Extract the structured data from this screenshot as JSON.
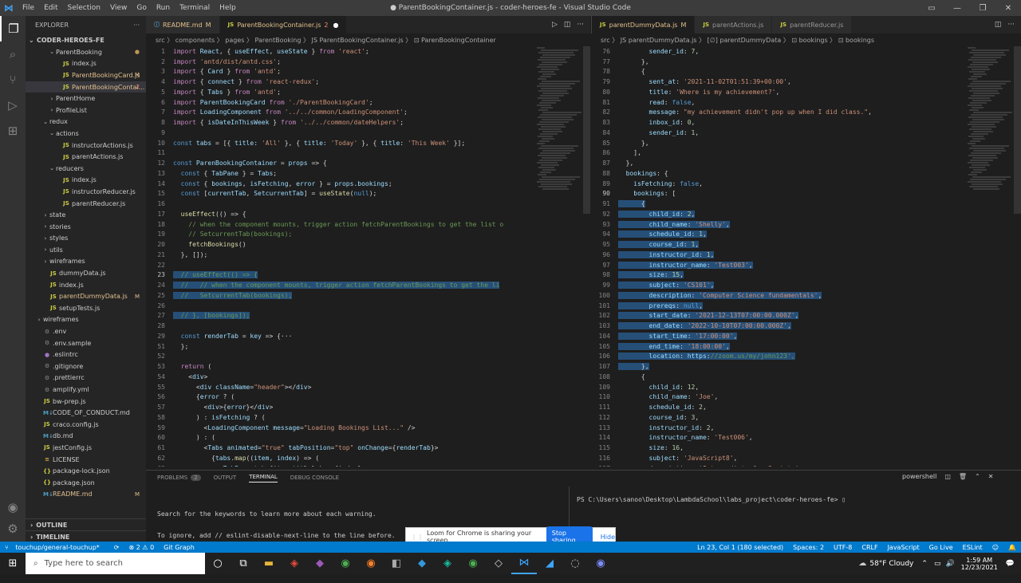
{
  "title_bar": {
    "menus": [
      "File",
      "Edit",
      "Selection",
      "View",
      "Go",
      "Run",
      "Terminal",
      "Help"
    ],
    "window_title": "● ParentBookingContainer.js - coder-heroes-fe - Visual Studio Code"
  },
  "activity_bar": [
    "explorer-icon",
    "search-icon",
    "source-control-icon",
    "run-debug-icon",
    "extensions-icon"
  ],
  "sidebar": {
    "header": "EXPLORER",
    "root": "CODER-HEROES-FE",
    "items": [
      {
        "label": "ParentBooking",
        "kind": "folder",
        "depth": 3,
        "open": true,
        "status": "dot"
      },
      {
        "label": "index.js",
        "kind": "js",
        "depth": 4,
        "status": ""
      },
      {
        "label": "ParentBookingCard.js",
        "kind": "js",
        "depth": 4,
        "status": "M"
      },
      {
        "label": "ParentBookingContai...",
        "kind": "js",
        "depth": 4,
        "status": "2",
        "selected": true
      },
      {
        "label": "ParentHome",
        "kind": "folder",
        "depth": 3,
        "open": false,
        "status": ""
      },
      {
        "label": "ProfileList",
        "kind": "folder",
        "depth": 3,
        "open": false,
        "status": ""
      },
      {
        "label": "redux",
        "kind": "folder",
        "depth": 2,
        "open": true,
        "status": ""
      },
      {
        "label": "actions",
        "kind": "folder",
        "depth": 3,
        "open": true,
        "status": ""
      },
      {
        "label": "instructorActions.js",
        "kind": "js",
        "depth": 4,
        "status": ""
      },
      {
        "label": "parentActions.js",
        "kind": "js",
        "depth": 4,
        "status": ""
      },
      {
        "label": "reducers",
        "kind": "folder",
        "depth": 3,
        "open": true,
        "status": ""
      },
      {
        "label": "index.js",
        "kind": "js",
        "depth": 4,
        "status": ""
      },
      {
        "label": "instructorReducer.js",
        "kind": "js",
        "depth": 4,
        "status": ""
      },
      {
        "label": "parentReducer.js",
        "kind": "js",
        "depth": 4,
        "status": ""
      },
      {
        "label": "state",
        "kind": "folder",
        "depth": 2,
        "open": false,
        "status": ""
      },
      {
        "label": "stories",
        "kind": "folder",
        "depth": 2,
        "open": false,
        "status": ""
      },
      {
        "label": "styles",
        "kind": "folder",
        "depth": 2,
        "open": false,
        "status": ""
      },
      {
        "label": "utils",
        "kind": "folder",
        "depth": 2,
        "open": false,
        "status": ""
      },
      {
        "label": "wireframes",
        "kind": "folder",
        "depth": 2,
        "open": false,
        "status": ""
      },
      {
        "label": "dummyData.js",
        "kind": "js",
        "depth": 2,
        "status": ""
      },
      {
        "label": "index.js",
        "kind": "js",
        "depth": 2,
        "status": ""
      },
      {
        "label": "parentDummyData.js",
        "kind": "js",
        "depth": 2,
        "status": "M"
      },
      {
        "label": "setupTests.js",
        "kind": "js",
        "depth": 2,
        "status": ""
      },
      {
        "label": "wireframes",
        "kind": "folder",
        "depth": 1,
        "open": false,
        "status": ""
      },
      {
        "label": ".env",
        "kind": "gear",
        "depth": 1,
        "status": ""
      },
      {
        "label": ".env.sample",
        "kind": "gear",
        "depth": 1,
        "status": ""
      },
      {
        "label": ".eslintrc",
        "kind": "dot",
        "depth": 1,
        "status": ""
      },
      {
        "label": ".gitignore",
        "kind": "gear",
        "depth": 1,
        "status": ""
      },
      {
        "label": ".prettierrc",
        "kind": "gear",
        "depth": 1,
        "status": ""
      },
      {
        "label": "amplify.yml",
        "kind": "gear",
        "depth": 1,
        "status": ""
      },
      {
        "label": "bw-prep.js",
        "kind": "js",
        "depth": 1,
        "status": ""
      },
      {
        "label": "CODE_OF_CONDUCT.md",
        "kind": "md",
        "depth": 1,
        "status": ""
      },
      {
        "label": "craco.config.js",
        "kind": "js",
        "depth": 1,
        "status": ""
      },
      {
        "label": "db.md",
        "kind": "md",
        "depth": 1,
        "status": ""
      },
      {
        "label": "jestConfig.js",
        "kind": "js",
        "depth": 1,
        "status": ""
      },
      {
        "label": "LICENSE",
        "kind": "lic",
        "depth": 1,
        "status": ""
      },
      {
        "label": "package-lock.json",
        "kind": "json",
        "depth": 1,
        "status": ""
      },
      {
        "label": "package.json",
        "kind": "json",
        "depth": 1,
        "status": ""
      },
      {
        "label": "README.md",
        "kind": "md",
        "depth": 1,
        "status": "M"
      }
    ],
    "outline": "OUTLINE",
    "timeline": "TIMELINE"
  },
  "left_editor": {
    "tabs": [
      {
        "label": "README.md",
        "badge": "M",
        "active": false,
        "icon": "md"
      },
      {
        "label": "ParentBookingContainer.js",
        "badge": "2",
        "active": true,
        "icon": "js",
        "unsaved": true
      }
    ],
    "breadcrumb": "src 〉 components 〉 pages 〉 ParentBooking 〉 JS ParentBookingContainer.js 〉 ⊡ ParenBookingContainer",
    "lines": [
      {
        "n": "1",
        "t": "import React, { useEffect, useState } from 'react';"
      },
      {
        "n": "2",
        "t": "import 'antd/dist/antd.css';"
      },
      {
        "n": "3",
        "t": "import { Card } from 'antd';"
      },
      {
        "n": "4",
        "t": "import { connect } from 'react-redux';"
      },
      {
        "n": "5",
        "t": "import { Tabs } from 'antd';"
      },
      {
        "n": "6",
        "t": "import ParentBookingCard from './ParentBookingCard';"
      },
      {
        "n": "7",
        "t": "import LoadingComponent from '../../common/LoadingComponent';"
      },
      {
        "n": "8",
        "t": "import { isDateInThisWeek } from '../../common/dateHelpers';"
      },
      {
        "n": "9",
        "t": ""
      },
      {
        "n": "10",
        "t": "const tabs = [{ title: 'All' }, { title: 'Today' }, { title: 'This Week' }];"
      },
      {
        "n": "11",
        "t": ""
      },
      {
        "n": "12",
        "t": "const ParenBookingContainer = props => {"
      },
      {
        "n": "13",
        "t": "  const { TabPane } = Tabs;"
      },
      {
        "n": "14",
        "t": "  const { bookings, isFetching, error } = props.bookings;"
      },
      {
        "n": "15",
        "t": "  const [currentTab, SetcurrentTab] = useState(null);"
      },
      {
        "n": "16",
        "t": ""
      },
      {
        "n": "17",
        "t": "  useEffect(() => {"
      },
      {
        "n": "18",
        "t": "    // when the component mounts, trigger action fetchParentBookings to get the list o"
      },
      {
        "n": "19",
        "t": "    // SetcurrentTab(bookings);"
      },
      {
        "n": "20",
        "t": "    fetchBookings()"
      },
      {
        "n": "21",
        "t": "  }, []);"
      },
      {
        "n": "22",
        "t": ""
      },
      {
        "n": "23",
        "t": "  // useEffect(() => {",
        "hl": true
      },
      {
        "n": "24",
        "t": "  //   // when the component mounts, trigger action fetchParentBookings to get the li",
        "hl": true
      },
      {
        "n": "25",
        "t": "  //   SetcurrentTab(bookings);",
        "hl": true
      },
      {
        "n": "26",
        "t": "",
        "hl": true
      },
      {
        "n": "27",
        "t": "  // }, [bookings]);",
        "hl": true
      },
      {
        "n": "28",
        "t": ""
      },
      {
        "n": "29",
        "t": "  const renderTab = key => {···"
      },
      {
        "n": "51",
        "t": "  };"
      },
      {
        "n": "52",
        "t": ""
      },
      {
        "n": "53",
        "t": "  return ("
      },
      {
        "n": "54",
        "t": "    <div>"
      },
      {
        "n": "55",
        "t": "      <div className=\"header\"></div>"
      },
      {
        "n": "56",
        "t": "      {error ? ("
      },
      {
        "n": "57",
        "t": "        <div>{error}</div>"
      },
      {
        "n": "58",
        "t": "      ) : isFetching ? ("
      },
      {
        "n": "59",
        "t": "        <LoadingComponent message=\"Loading Bookings List...\" />"
      },
      {
        "n": "60",
        "t": "      ) : ("
      },
      {
        "n": "61",
        "t": "        <Tabs animated=\"true\" tabPosition=\"top\" onChange={renderTab}>"
      },
      {
        "n": "62",
        "t": "          {tabs.map((item, index) => ("
      },
      {
        "n": "63",
        "t": "            <TabPane tab={item.title} key={index}>"
      }
    ]
  },
  "right_editor": {
    "tabs": [
      {
        "label": "parentDummyData.js",
        "badge": "M",
        "active": true,
        "icon": "js"
      },
      {
        "label": "parentActions.js",
        "badge": "",
        "active": false,
        "icon": "js"
      },
      {
        "label": "parentReducer.js",
        "badge": "",
        "active": false,
        "icon": "js"
      }
    ],
    "breadcrumb": "src 〉 JS parentDummyData.js 〉 [∅] parentDummyData 〉 ⊡ bookings 〉 ⊡ bookings",
    "lines": [
      {
        "n": "76",
        "t": "        sender_id: 7,"
      },
      {
        "n": "77",
        "t": "      },"
      },
      {
        "n": "78",
        "t": "      {"
      },
      {
        "n": "79",
        "t": "        sent_at: '2021-11-02T01:51:39+00:00',"
      },
      {
        "n": "80",
        "t": "        title: 'Where is my achievement?',"
      },
      {
        "n": "81",
        "t": "        read: false,"
      },
      {
        "n": "82",
        "t": "        message: \"my achievement didn't pop up when I did class.\","
      },
      {
        "n": "83",
        "t": "        inbox_id: 0,"
      },
      {
        "n": "84",
        "t": "        sender_id: 1,"
      },
      {
        "n": "85",
        "t": "      },"
      },
      {
        "n": "86",
        "t": "    ],"
      },
      {
        "n": "87",
        "t": "  },"
      },
      {
        "n": "88",
        "t": "  bookings: {"
      },
      {
        "n": "89",
        "t": "    isFetching: false,"
      },
      {
        "n": "90",
        "t": "    bookings: ["
      },
      {
        "n": "91",
        "t": "      {",
        "hl": true
      },
      {
        "n": "92",
        "t": "        child_id: 2,",
        "hl": true
      },
      {
        "n": "93",
        "t": "        child_name: 'Shelly',",
        "hl": true
      },
      {
        "n": "94",
        "t": "        schedule_id: 1,",
        "hl": true
      },
      {
        "n": "95",
        "t": "        course_id: 1,",
        "hl": true
      },
      {
        "n": "96",
        "t": "        instructor_id: 1,",
        "hl": true
      },
      {
        "n": "97",
        "t": "        instructor_name: 'Test003',",
        "hl": true
      },
      {
        "n": "98",
        "t": "        size: 15,",
        "hl": true
      },
      {
        "n": "99",
        "t": "        subject: 'CS101',",
        "hl": true
      },
      {
        "n": "100",
        "t": "        description: 'Computer Science fundamentals',",
        "hl": true
      },
      {
        "n": "101",
        "t": "        prereqs: null,",
        "hl": true
      },
      {
        "n": "102",
        "t": "        start_date: '2021-12-13T07:00:00.000Z',",
        "hl": true
      },
      {
        "n": "103",
        "t": "        end_date: '2022-10-10T07:00:00.000Z',",
        "hl": true
      },
      {
        "n": "104",
        "t": "        start_time: '17:00:00',",
        "hl": true
      },
      {
        "n": "105",
        "t": "        end_time: '18:00:00',",
        "hl": true
      },
      {
        "n": "106",
        "t": "        location: 'https://zoom.us/my/john123',",
        "hl": true
      },
      {
        "n": "107",
        "t": "      },",
        "hl": true
      },
      {
        "n": "108",
        "t": "      {"
      },
      {
        "n": "109",
        "t": "        child_id: 12,"
      },
      {
        "n": "110",
        "t": "        child_name: 'Joe',"
      },
      {
        "n": "111",
        "t": "        schedule_id: 2,"
      },
      {
        "n": "112",
        "t": "        course_id: 3,"
      },
      {
        "n": "113",
        "t": "        instructor_id: 2,"
      },
      {
        "n": "114",
        "t": "        instructor_name: 'Test006',"
      },
      {
        "n": "115",
        "t": "        size: 16,"
      },
      {
        "n": "116",
        "t": "        subject: 'JavaScript8',"
      },
      {
        "n": "117",
        "t": "        description: 'Intermediate JavaScript.',"
      },
      {
        "n": "118",
        "t": "        prereqs: ['JavaScript4'],"
      }
    ]
  },
  "panel": {
    "tabs": [
      {
        "label": "PROBLEMS",
        "badge": "2"
      },
      {
        "label": "OUTPUT",
        "badge": ""
      },
      {
        "label": "TERMINAL",
        "badge": "",
        "active": true
      },
      {
        "label": "DEBUG CONSOLE",
        "badge": ""
      }
    ],
    "shell": "powershell",
    "left_term": [
      "Search for the keywords to learn more about each warning.",
      "To ignore, add // eslint-disable-next-line to the line before."
    ],
    "right_term": "PS C:\\Users\\sanoo\\Desktop\\LambdaSchool\\labs_project\\coder-heroes-fe> "
  },
  "loom": {
    "message": "Loom for Chrome is sharing your screen.",
    "stop": "Stop sharing",
    "hide": "Hide"
  },
  "status": {
    "branch": "touchup/general-touchup*",
    "problems": "⊗ 2 ⚠ 0",
    "git_graph": "Git Graph",
    "position": "Ln 23, Col 1 (180 selected)",
    "spaces": "Spaces: 2",
    "encoding": "UTF-8",
    "eol": "CRLF",
    "language": "JavaScript",
    "golive": "Go Live",
    "eslint": "ESLint"
  },
  "taskbar": {
    "search_placeholder": "Type here to search",
    "weather": "58°F  Cloudy",
    "time": "1:59 AM",
    "date": "12/23/2021"
  }
}
